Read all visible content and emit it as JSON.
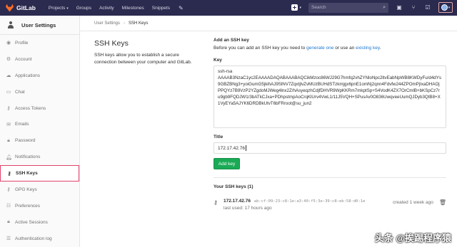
{
  "navbar": {
    "brand": "GitLab",
    "links": [
      "Projects",
      "Groups",
      "Activity",
      "Milestones",
      "Snippets"
    ],
    "search_placeholder": "Search"
  },
  "sidebar": {
    "title": "User Settings",
    "items": [
      {
        "label": "Profile",
        "icon": "user-circle-icon"
      },
      {
        "label": "Account",
        "icon": "gear-icon"
      },
      {
        "label": "Applications",
        "icon": "cloud-icon"
      },
      {
        "label": "Chat",
        "icon": "chat-icon"
      },
      {
        "label": "Access Tokens",
        "icon": "key-icon"
      },
      {
        "label": "Emails",
        "icon": "envelope-icon"
      },
      {
        "label": "Password",
        "icon": "lock-icon"
      },
      {
        "label": "Notifications",
        "icon": "bell-icon"
      },
      {
        "label": "SSH Keys",
        "icon": "key-icon",
        "active": true
      },
      {
        "label": "GPG Keys",
        "icon": "key-icon"
      },
      {
        "label": "Preferences",
        "icon": "sliders-icon"
      },
      {
        "label": "Active Sessions",
        "icon": "lock-icon"
      },
      {
        "label": "Authentication log",
        "icon": "list-icon"
      }
    ]
  },
  "breadcrumb": {
    "parent": "User Settings",
    "current": "SSH Keys"
  },
  "intro": {
    "title": "SSH Keys",
    "description": "SSH keys allow you to establish a secure connection between your computer and GitLab."
  },
  "add_key": {
    "heading": "Add an SSH key",
    "desc_prefix": "Before you can add an SSH key you need to ",
    "generate_link": "generate one",
    "desc_middle": " or use an ",
    "existing_link": "existing key",
    "desc_suffix": ".",
    "key_label": "Key",
    "key_value": "ssh-rsa\nAAAAB3NzaC1yc2EAAAADAQABAAABAQCikMzoc86WJ29G7hmfq2vhZYNloNpc2ltvEabNpWB8KWDyFu/d4dYs9GBZBNg3+yoiGumG5jkihAJ9SlNV7ZqxtjlvZvMUzBUHdSTzkmjgx6pnE1omNj2qnn4Fdvfw244ZPOmPjIxaDHAOjPPQYz7B9VzP2YZgdoMJWeg4lnx2Z/hAsyeqzhCdjfDHVR9WpKKRm7mkptSp+S4VodK4ZX7OrCmlB+bKSpCz7ru9gb9FQDJW1/3bATkCJxa+PDhpstmpAoCrqKlUrv4VwL1/11J5VQH+SPusAv0O836UwqveeUumQJDyb3QtB8+X1VyEYa5AJYK6DRDBkUtvT6bFRroot@su_jun2",
    "title_label": "Title",
    "title_value": "172.17.42.76",
    "button": "Add key"
  },
  "your_keys": {
    "heading": "Your SSH keys (1)",
    "keys": [
      {
        "title": "172.17.42.76",
        "fingerprint": "ab:cf:09:23:c8:1e:a3:40:f5:3e:39:c8:eb:58:d0:1e",
        "last_used": "last used: 17 hours ago",
        "created": "created 1 week ago"
      }
    ]
  },
  "watermark": "头条 @挨踢程序猿",
  "colors": {
    "navbar": "#2b2a4f",
    "accent_link": "#1f78d1",
    "add_button": "#1aaa55",
    "active_highlight": "#e0446b"
  }
}
